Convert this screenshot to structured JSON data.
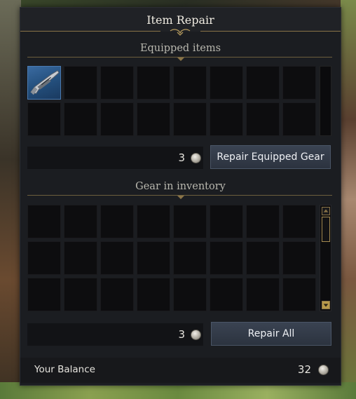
{
  "window": {
    "title": "Item Repair"
  },
  "equipped": {
    "heading": "Equipped items",
    "filled_slot_icon": "rifle-icon",
    "cost": "3",
    "button_label": "Repair Equipped Gear"
  },
  "inventory": {
    "heading": "Gear in inventory",
    "cost": "3",
    "button_label": "Repair All"
  },
  "balance": {
    "label": "Your Balance",
    "value": "32"
  },
  "colors": {
    "accent_gold": "#8a7448",
    "panel_bg": "#1b1d21",
    "button_bg": "#323a47",
    "equipped_slot": "#2c5a8a"
  },
  "icons": {
    "currency": "coin-icon",
    "scroll_up": "arrow-up-icon",
    "scroll_down": "arrow-down-icon"
  }
}
